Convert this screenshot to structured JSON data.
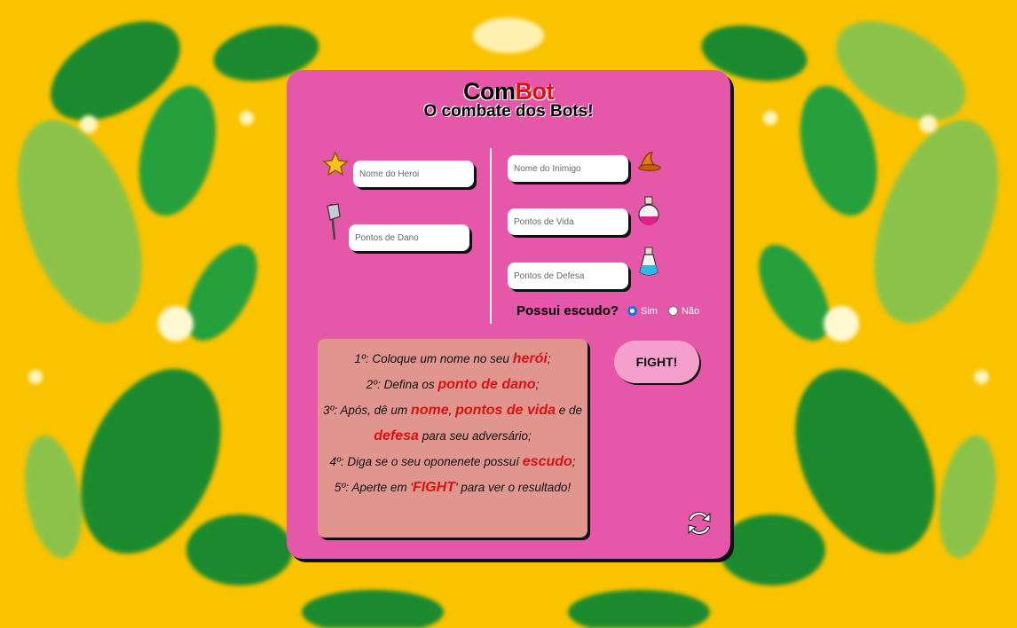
{
  "app": {
    "title_part1": "Com",
    "title_part2": "Bot",
    "subtitle": "O combate dos Bots!"
  },
  "hero": {
    "name_placeholder": "Nome do Heroi",
    "damage_placeholder": "Pontos de Dano"
  },
  "enemy": {
    "name_placeholder": "Nome do Inimigo",
    "life_placeholder": "Pontos de Vida",
    "defense_placeholder": "Pontos de Defesa",
    "shield_question": "Possui escudo?",
    "shield_options": [
      "Sim",
      "Não"
    ],
    "shield_selected": "Sim"
  },
  "instructions": {
    "line1": {
      "a": "1º: Coloque um nome no seu ",
      "h1": "herói",
      "b": ";"
    },
    "line2": {
      "a": "2º: Defina os ",
      "h1": "ponto de dano",
      "b": ";"
    },
    "line3": {
      "a": "3º: Após, dê um ",
      "h1": "nome",
      "b": ", ",
      "h2": "pontos de vida",
      "c": " e de"
    },
    "line4": {
      "h1": "defesa",
      "a": " para seu adversário;"
    },
    "line5": {
      "a": "4º: Diga se o seu oponenete possuí ",
      "h1": "escudo",
      "b": ";"
    },
    "line6": {
      "a": "5º: Aperte em '",
      "h1": "FIGHT",
      "b": "' para ver o resultado!"
    }
  },
  "actions": {
    "fight_label": "FIGHT!",
    "reset_icon": "refresh-icon"
  },
  "colors": {
    "background": "#f9c300",
    "card": "#e557a8",
    "accent_red": "#d81212",
    "instructions_bg": "#e0958f",
    "fight_button": "#f5a0cc"
  }
}
